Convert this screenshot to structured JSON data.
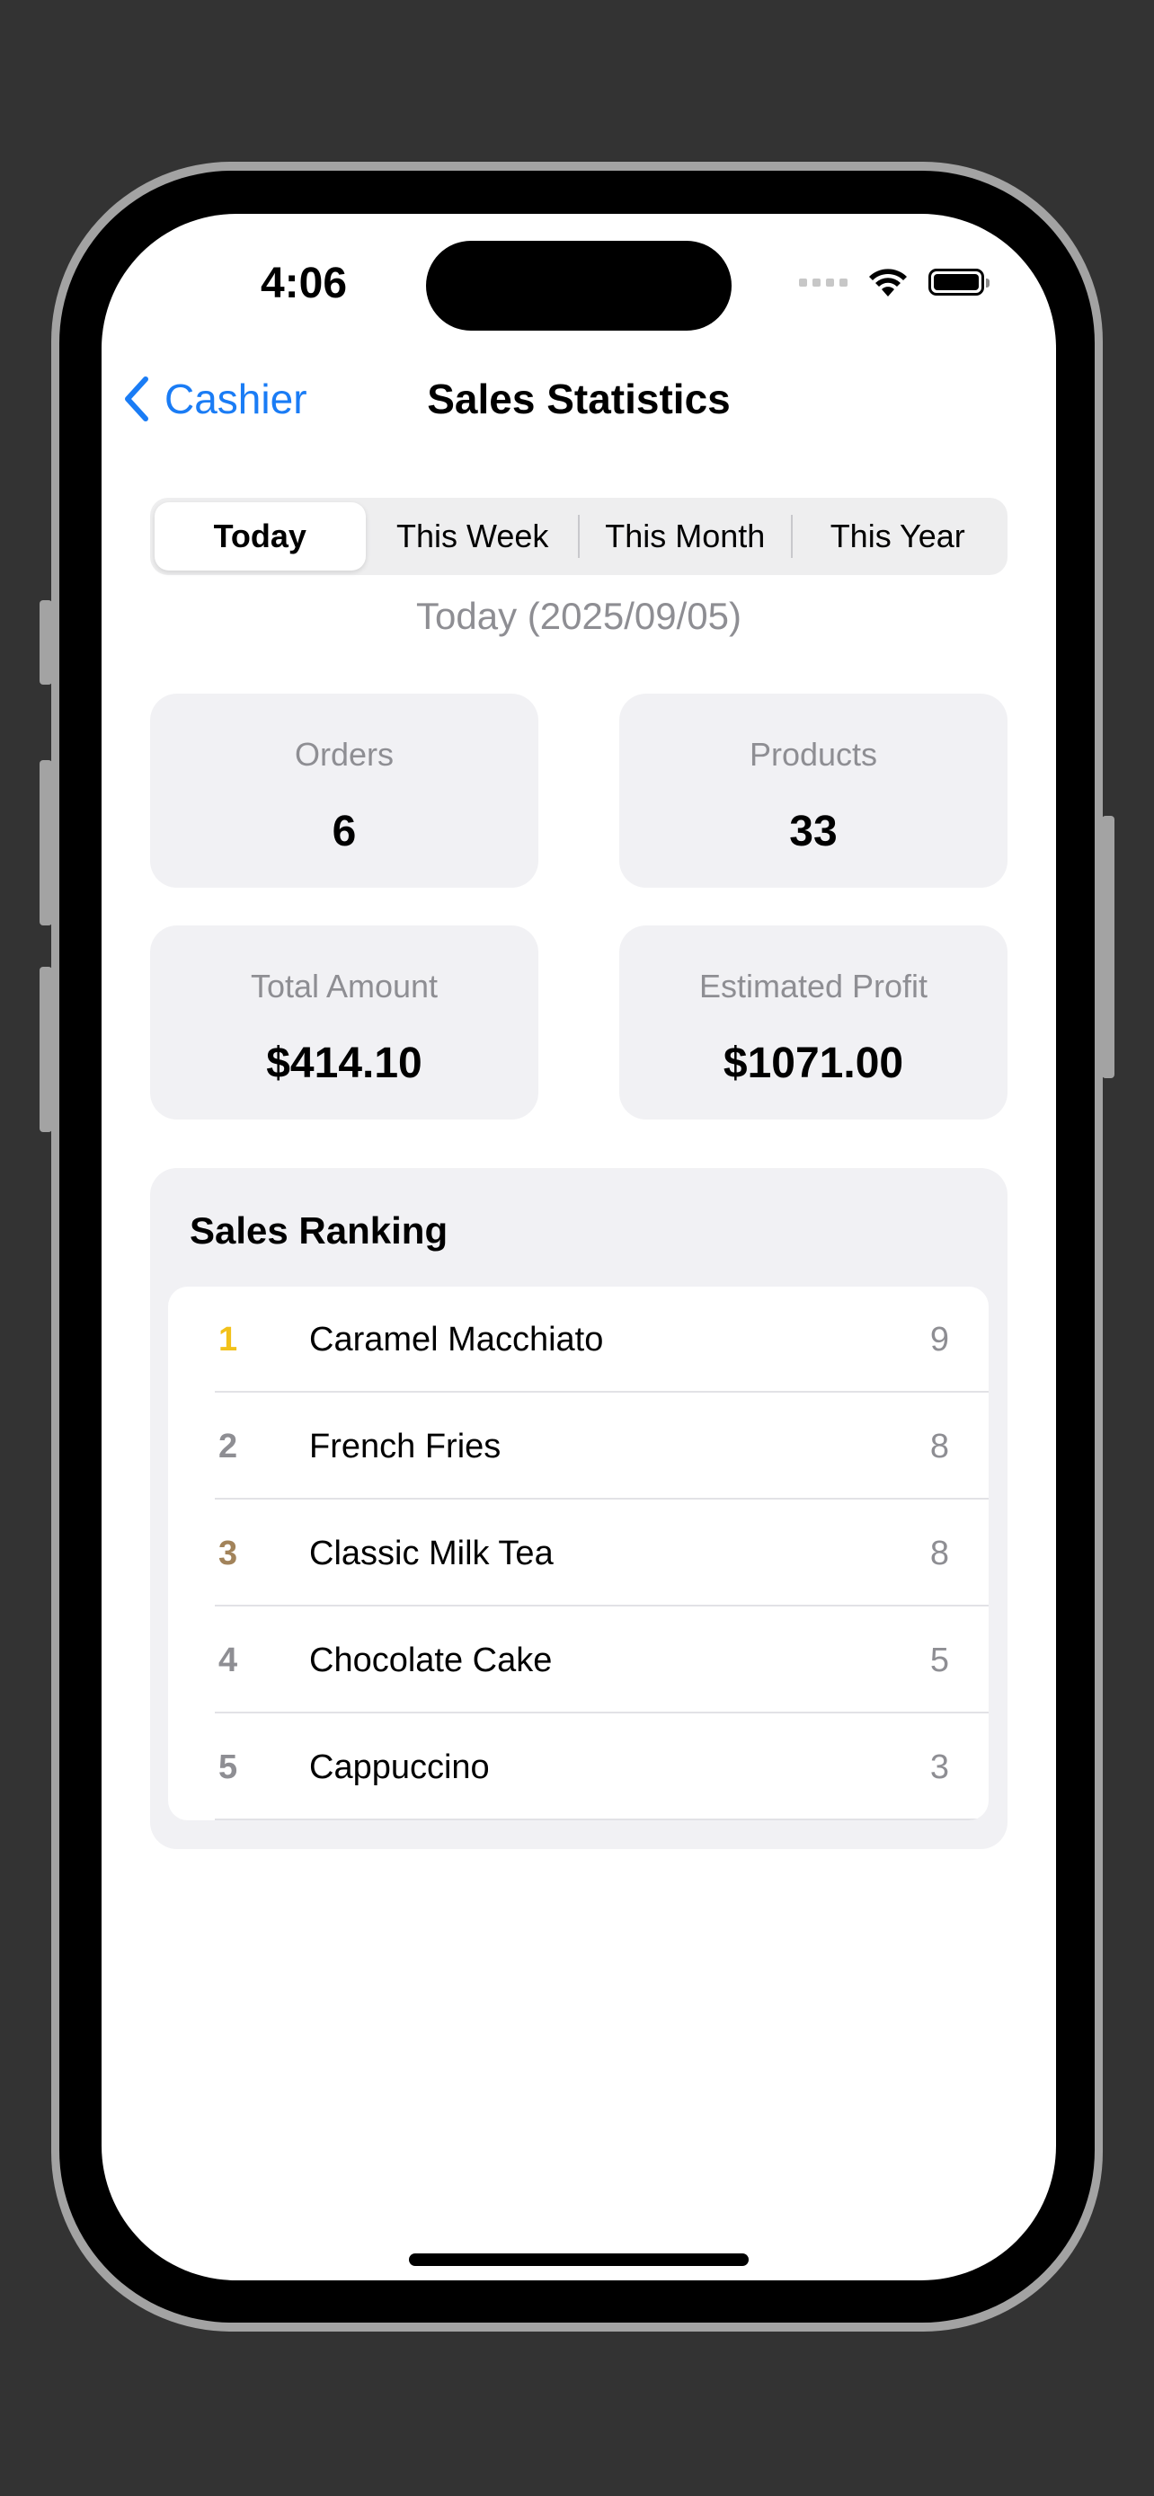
{
  "status_bar": {
    "time": "4:06"
  },
  "nav": {
    "back_label": "Cashier",
    "title": "Sales Statistics"
  },
  "periods": [
    {
      "label": "Today",
      "selected": true
    },
    {
      "label": "This Week",
      "selected": false
    },
    {
      "label": "This Month",
      "selected": false
    },
    {
      "label": "This Year",
      "selected": false
    }
  ],
  "date_label": "Today (2025/09/05)",
  "stats": {
    "orders": {
      "label": "Orders",
      "value": "6"
    },
    "products": {
      "label": "Products",
      "value": "33"
    },
    "total_amount": {
      "label": "Total Amount",
      "value": "$414.10"
    },
    "estimated_profit": {
      "label": "Estimated Profit",
      "value": "$1071.00"
    }
  },
  "ranking": {
    "title": "Sales Ranking",
    "items": [
      {
        "rank": "1",
        "name": "Caramel Macchiato",
        "count": "9",
        "rank_color": "#f2c11a"
      },
      {
        "rank": "2",
        "name": "French Fries",
        "count": "8",
        "rank_color": "#8e8e93"
      },
      {
        "rank": "3",
        "name": "Classic Milk Tea",
        "count": "8",
        "rank_color": "#a2835a"
      },
      {
        "rank": "4",
        "name": "Chocolate Cake",
        "count": "5",
        "rank_color": "#8e8e93"
      },
      {
        "rank": "5",
        "name": "Cappuccino",
        "count": "3",
        "rank_color": "#8e8e93"
      }
    ]
  },
  "colors": {
    "accent": "#1a7cf5",
    "card_bg": "#f1f1f4",
    "secondary_text": "#8e8e93"
  }
}
